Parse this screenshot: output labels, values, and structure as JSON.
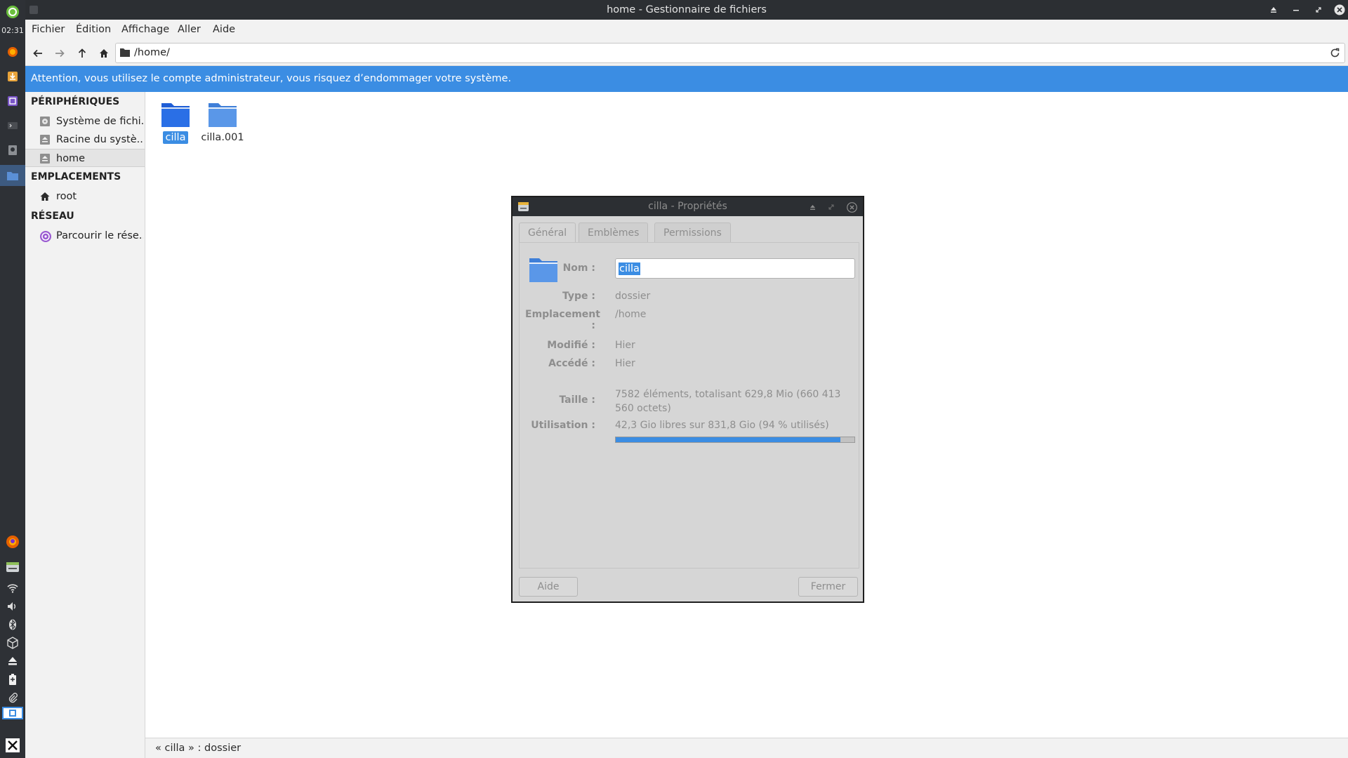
{
  "taskbar": {
    "clock": "02:31",
    "launchers": [
      "app-menu-icon",
      "firefox-icon",
      "download-icon",
      "notes-icon",
      "terminal-icon",
      "disk-icon",
      "file-manager-icon"
    ],
    "tray": [
      "firefox-tray-icon",
      "drive-tray-icon",
      "wifi-icon",
      "volume-icon",
      "bluetooth-icon",
      "package-icon",
      "eject-icon",
      "battery-icon",
      "clip-icon",
      "workspace-icon",
      "desktop-icon"
    ]
  },
  "window": {
    "title": "home - Gestionnaire de fichiers"
  },
  "menu": {
    "items": [
      "Fichier",
      "Édition",
      "Affichage",
      "Aller",
      "Aide"
    ]
  },
  "toolbar": {
    "path": "/home/"
  },
  "infobar": {
    "text": "Attention, vous utilisez le compte administrateur, vous risquez d’endommager votre système."
  },
  "sidepane": {
    "sections": [
      {
        "title": "PÉRIPHÉRIQUES",
        "items": [
          "Système de fichi...",
          "Racine du systè...",
          "home"
        ]
      },
      {
        "title": "EMPLACEMENTS",
        "items": [
          "root"
        ]
      },
      {
        "title": "RÉSEAU",
        "items": [
          "Parcourir le rése..."
        ]
      }
    ]
  },
  "files": [
    {
      "name": "cilla",
      "selected": true
    },
    {
      "name": "cilla.001",
      "selected": false
    }
  ],
  "statusbar": {
    "text": "« cilla » : dossier"
  },
  "dialog": {
    "title": "cilla - Propriétés",
    "tabs": [
      "Général",
      "Emblèmes",
      "Permissions"
    ],
    "fields": {
      "name_label": "Nom :",
      "name_value": "cilla",
      "type_label": "Type :",
      "type_value": "dossier",
      "location_label": "Emplacement :",
      "location_value": "/home",
      "modified_label": "Modifié :",
      "modified_value": "Hier",
      "accessed_label": "Accédé :",
      "accessed_value": "Hier",
      "size_label": "Taille :",
      "size_value": "7582 éléments, totalisant 629,8 Mio (660 413 560 octets)",
      "usage_label": "Utilisation :",
      "usage_value": "42,3 Gio libres sur 831,8 Gio (94 % utilisés)"
    },
    "usage_fraction": 0.94,
    "buttons": {
      "help": "Aide",
      "close": "Fermer"
    }
  },
  "colors": {
    "accent": "#3b8de3",
    "titlebar": "#2c2f33",
    "taskbar": "#2e3136"
  }
}
